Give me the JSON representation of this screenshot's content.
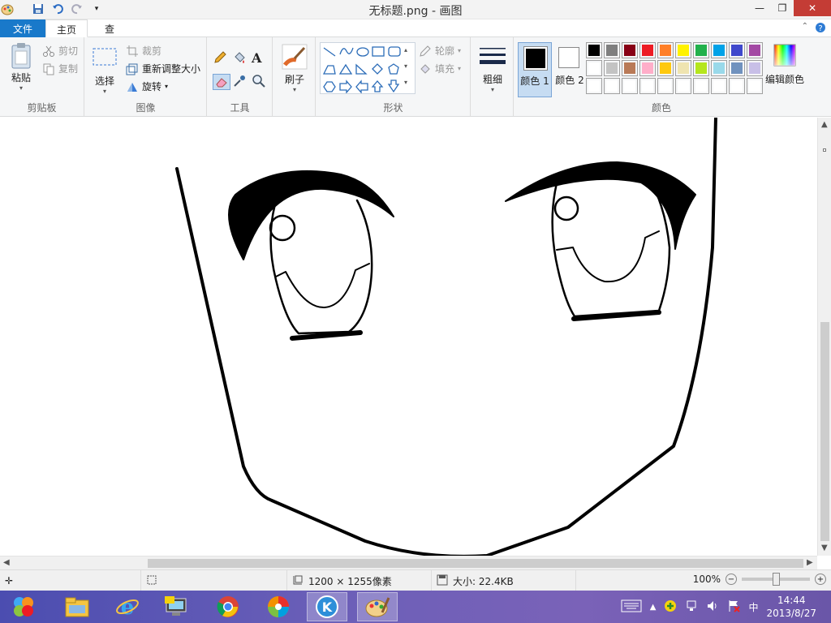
{
  "window": {
    "title": "无标题.png - 画图",
    "controls": {
      "minimize": "—",
      "restore": "❐",
      "close": "✕"
    }
  },
  "tabs": {
    "file": "文件",
    "home": "主页",
    "view": "查看"
  },
  "ribbon": {
    "clipboard": {
      "label": "剪贴板",
      "paste": "粘贴",
      "cut": "剪切",
      "copy": "复制"
    },
    "image": {
      "label": "图像",
      "select": "选择",
      "crop": "裁剪",
      "resize": "重新调整大小",
      "rotate": "旋转"
    },
    "tools": {
      "label": "工具"
    },
    "brushes": {
      "label": "刷子"
    },
    "shapes": {
      "label": "形状",
      "outline": "轮廓",
      "fill": "填充"
    },
    "size": {
      "label": "粗细"
    },
    "colors": {
      "label": "颜色",
      "color1": "颜色 1",
      "color2": "颜色 2",
      "edit": "编辑颜色",
      "color1_value": "#000000",
      "color2_value": "#ffffff",
      "palette_row1": [
        "#000000",
        "#7f7f7f",
        "#880015",
        "#ed1c24",
        "#ff7f27",
        "#fff200",
        "#22b14c",
        "#00a2e8",
        "#3f48cc",
        "#a349a4"
      ],
      "palette_row2": [
        "#ffffff",
        "#c3c3c3",
        "#b97a57",
        "#ffaec9",
        "#ffc90e",
        "#efe4b0",
        "#b5e61d",
        "#99d9ea",
        "#7092be",
        "#c8bfe7"
      ],
      "palette_row3": [
        "#ffffff",
        "#ffffff",
        "#ffffff",
        "#ffffff",
        "#ffffff",
        "#ffffff",
        "#ffffff",
        "#ffffff",
        "#ffffff",
        "#ffffff"
      ]
    }
  },
  "status": {
    "dimensions": "1200 × 1255像素",
    "size": "大小: 22.4KB",
    "zoom": "100%"
  },
  "taskbar": {
    "time": "14:44",
    "date": "2013/8/27",
    "ime": "中"
  }
}
